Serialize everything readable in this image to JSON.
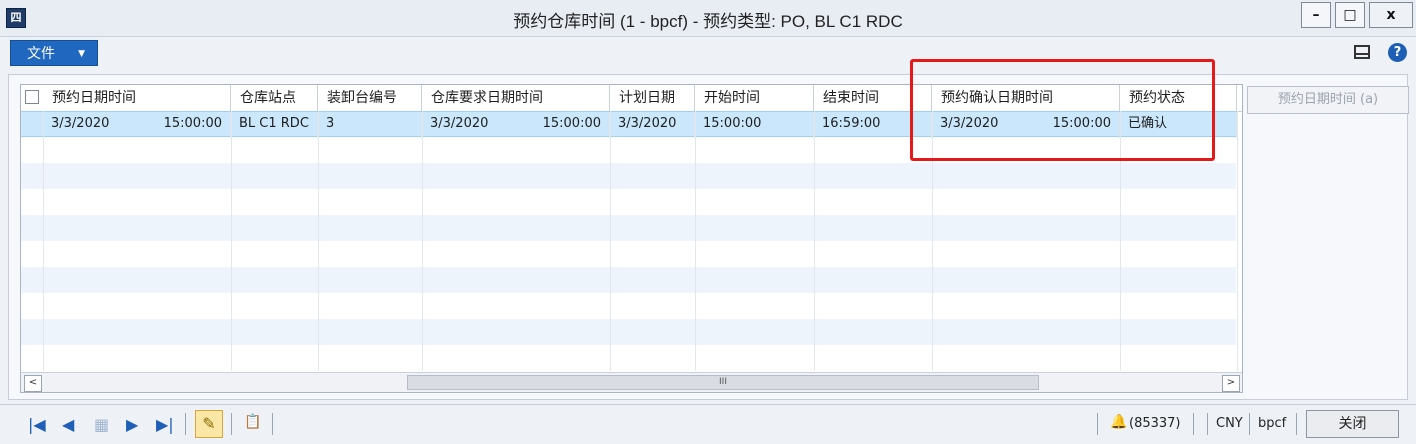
{
  "window": {
    "app_icon": "app-logo-icon",
    "title": "预约仓库时间 (1 - bpcf) - 预约类型: PO, BL C1 RDC",
    "minimize": "–",
    "maximize": "□",
    "close": "x"
  },
  "toolbar": {
    "file_label": "文件",
    "file_caret": "▼",
    "layout_icon": "layout-icon",
    "help_icon": "?"
  },
  "grid": {
    "columns": [
      "预约日期时间",
      "仓库站点",
      "装卸台编号",
      "仓库要求日期时间",
      "计划日期",
      "开始时间",
      "结束时间",
      "预约确认日期时间",
      "预约状态"
    ],
    "rows": [
      {
        "appt_date": "3/3/2020",
        "appt_time": "15:00:00",
        "site": "BL C1 RDC",
        "dock": "3",
        "req_date": "3/3/2020",
        "req_time": "15:00:00",
        "plan_date": "3/3/2020",
        "start_time": "15:00:00",
        "end_time": "16:59:00",
        "confirm_date": "3/3/2020",
        "confirm_time": "15:00:00",
        "status": "已确认"
      }
    ],
    "scroll_left": "<",
    "scroll_right": ">",
    "scroll_thumb": "III"
  },
  "side_button": "预约日期时间 (a)",
  "statusbar": {
    "first": "|◀",
    "prev": "◀",
    "grid_icon": "▦",
    "next": "▶",
    "last": "▶|",
    "edit_icon": "✎",
    "clipboard_icon": "📋",
    "bell_icon": "🔔",
    "notifications": "(85337)",
    "currency": "CNY",
    "company": "bpcf",
    "close_label": "关闭"
  },
  "colors": {
    "accent": "#1f67bf",
    "selected_row": "#cbe7fb",
    "highlight_box": "#e61919"
  }
}
